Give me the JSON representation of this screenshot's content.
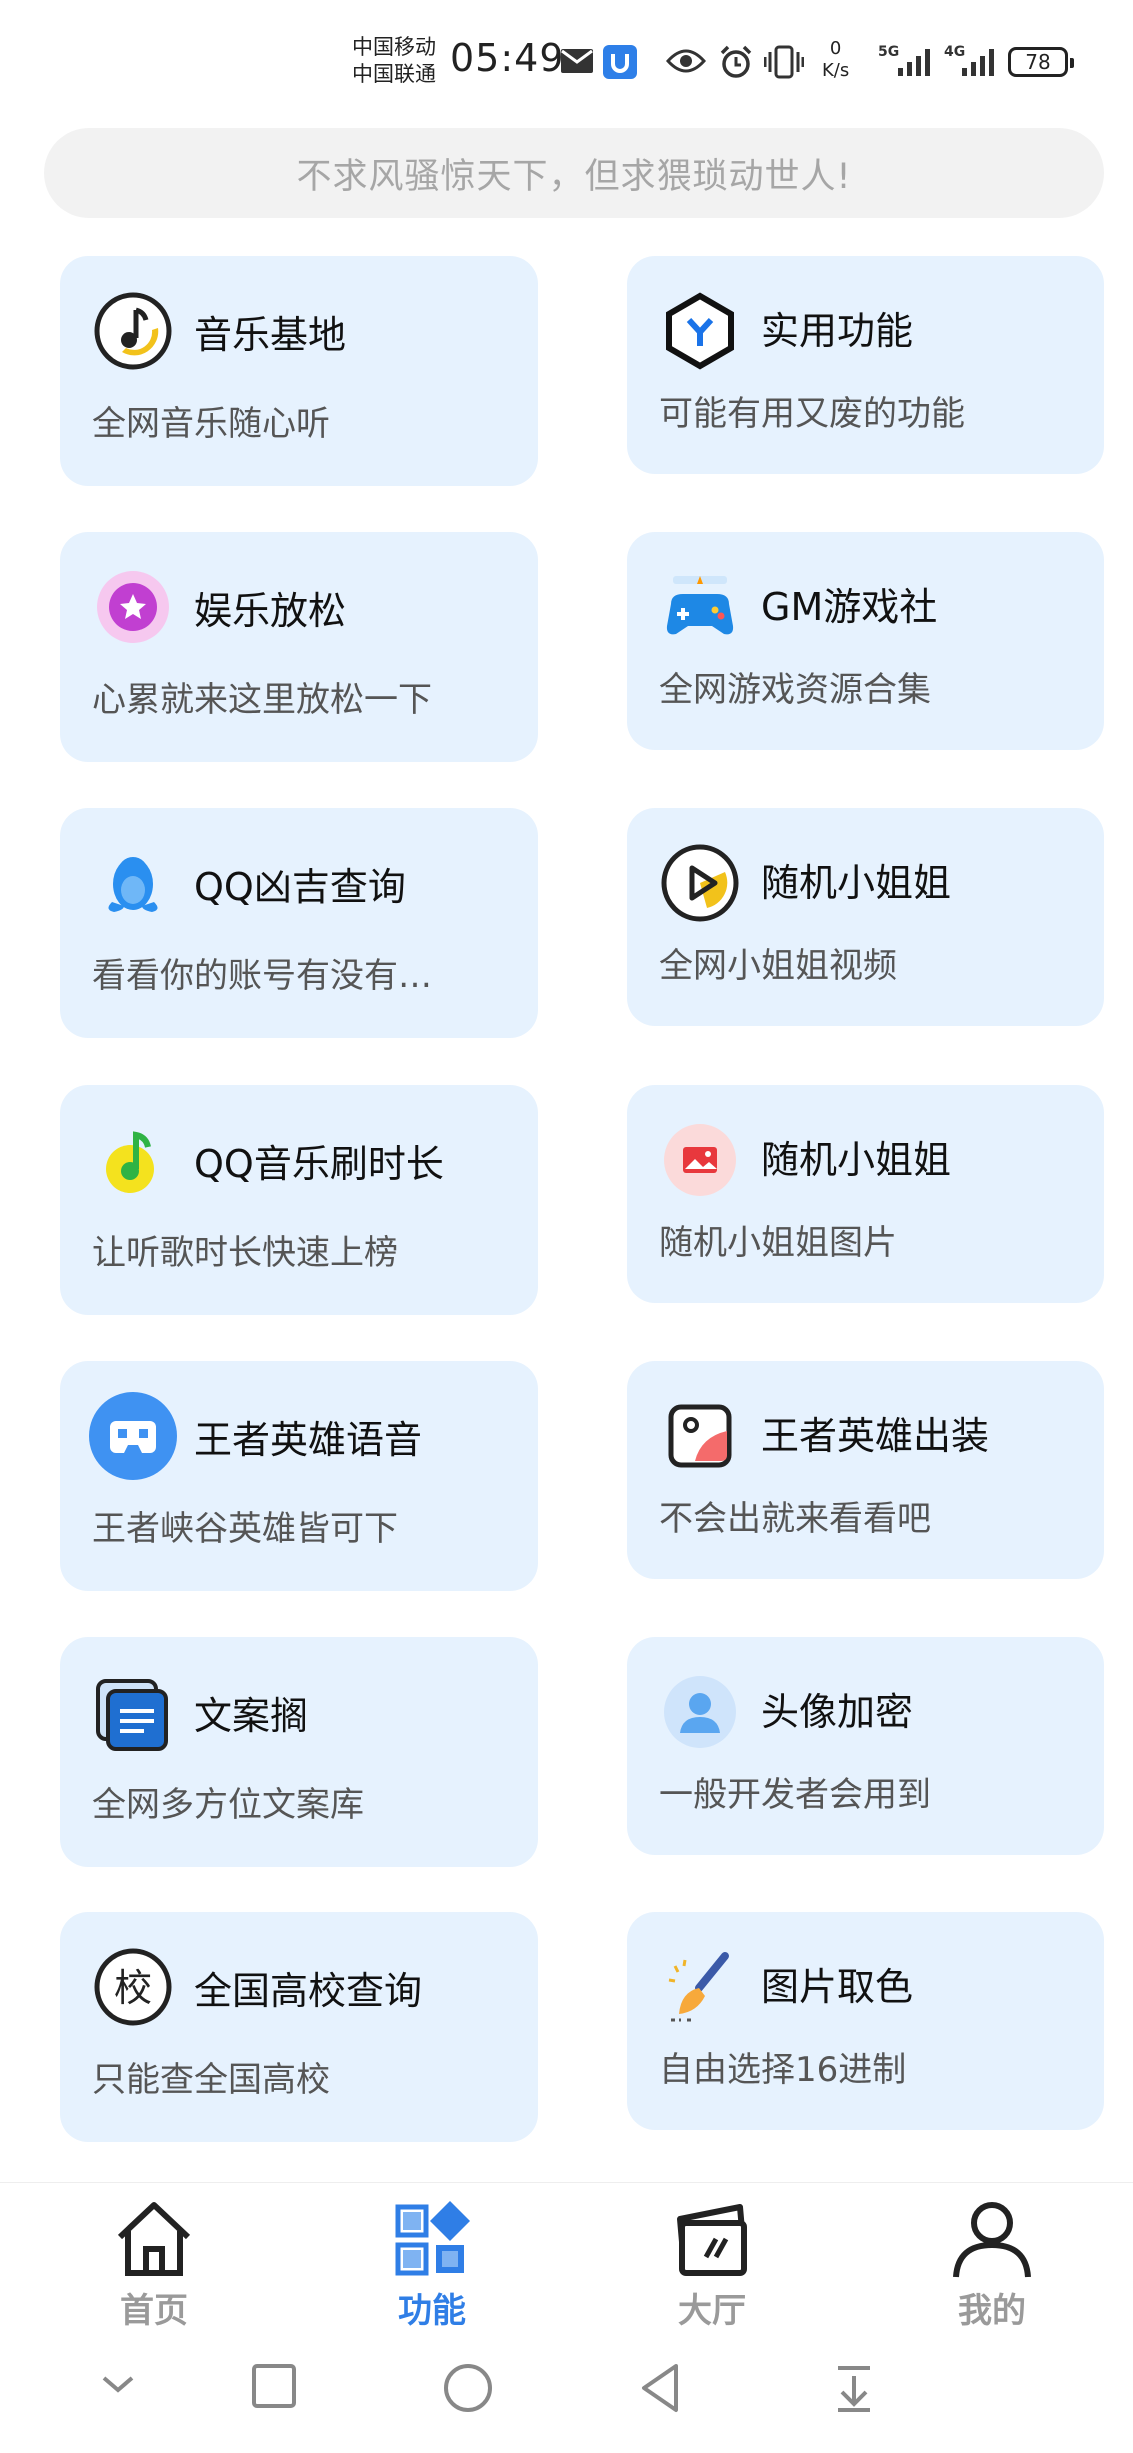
{
  "status_bar": {
    "carrier1": "中国移动",
    "carrier2": "中国联通",
    "time": "05:49",
    "net_speed_value": "0",
    "net_speed_unit": "K/s",
    "signal1_label": "5G",
    "signal2_label": "4G",
    "battery": "78"
  },
  "search": {
    "placeholder": "不求风骚惊天下，但求猥琐动世人!"
  },
  "cards": [
    {
      "title": "音乐基地",
      "subtitle": "全网音乐随心听",
      "icon": "music-disc-icon"
    },
    {
      "title": "实用功能",
      "subtitle": "可能有用又废的功能",
      "icon": "hexagon-y-icon"
    },
    {
      "title": "娱乐放松",
      "subtitle": "心累就来这里放松一下",
      "icon": "star-badge-icon"
    },
    {
      "title": "GM游戏社",
      "subtitle": "全网游戏资源合集",
      "icon": "gamepad-icon"
    },
    {
      "title": "QQ凶吉查询",
      "subtitle": "看看你的账号有没有…",
      "icon": "qq-penguin-icon"
    },
    {
      "title": "随机小姐姐",
      "subtitle": "全网小姐姐视频",
      "icon": "play-circle-icon"
    },
    {
      "title": "QQ音乐刷时长",
      "subtitle": "让听歌时长快速上榜",
      "icon": "qq-music-icon"
    },
    {
      "title": "随机小姐姐",
      "subtitle": "随机小姐姐图片",
      "icon": "picture-icon"
    },
    {
      "title": "王者英雄语音",
      "subtitle": "王者峡谷英雄皆可下",
      "icon": "voice-mask-icon"
    },
    {
      "title": "王者英雄出装",
      "subtitle": "不会出就来看看吧",
      "icon": "gallery-icon"
    },
    {
      "title": "文案搁",
      "subtitle": "全网多方位文案库",
      "icon": "document-stack-icon"
    },
    {
      "title": "头像加密",
      "subtitle": "一般开发者会用到",
      "icon": "avatar-icon"
    },
    {
      "title": "全国高校查询",
      "subtitle": "只能查全国高校",
      "icon": "school-icon"
    },
    {
      "title": "图片取色",
      "subtitle": "自由选择16进制",
      "icon": "paint-brush-icon"
    }
  ],
  "bottom_nav": {
    "items": [
      {
        "label": "首页",
        "icon": "home-icon",
        "active": false
      },
      {
        "label": "功能",
        "icon": "grid-icon",
        "active": true
      },
      {
        "label": "大厅",
        "icon": "hall-icon",
        "active": false
      },
      {
        "label": "我的",
        "icon": "person-icon",
        "active": false
      }
    ]
  },
  "colors": {
    "card_bg": "#e6f2fe",
    "active_nav": "#2f7ee6",
    "inactive_nav": "#9a9a9a"
  }
}
